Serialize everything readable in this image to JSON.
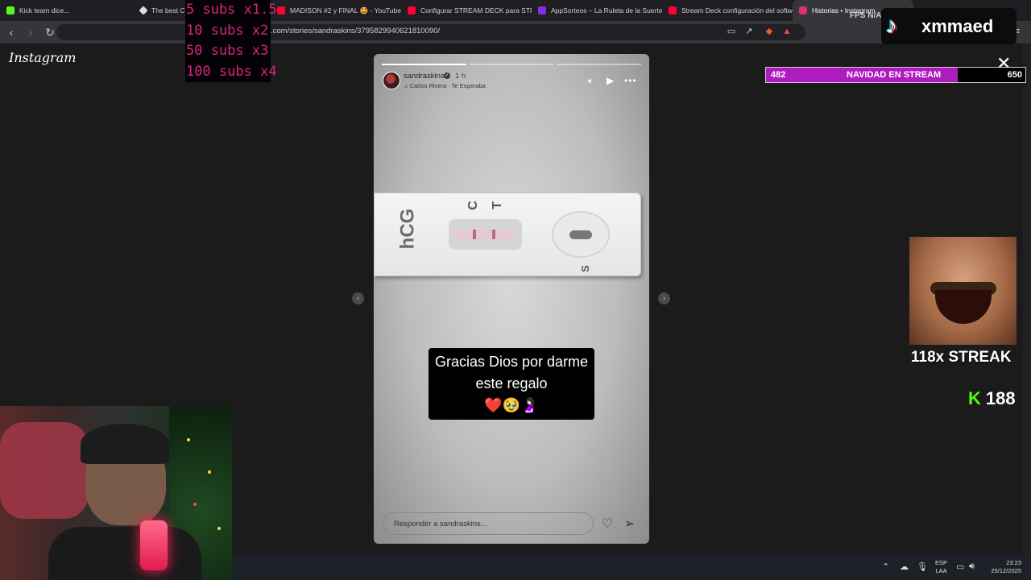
{
  "browser": {
    "tabs": [
      {
        "label": "Kick team dice...",
        "icon": "kick-icon",
        "color": "#53fc18"
      },
      {
        "label": "The best Ch",
        "icon": "diamond-icon",
        "color": "#dddddd"
      },
      {
        "label": "MADISON #2 y FINAL 🤩 - YouTube",
        "icon": "youtube-icon",
        "color": "#ff0033"
      },
      {
        "label": "Configurar STREAM DECK para STR",
        "icon": "youtube-icon",
        "color": "#ff0033"
      },
      {
        "label": "AppSorteos – La Ruleta de la Suerte",
        "icon": "appsorteos-icon",
        "color": "#8a2be2"
      },
      {
        "label": "Stream Deck configuración del softw",
        "icon": "youtube-icon",
        "color": "#ff0033"
      },
      {
        "label": "Historias • Instagram",
        "icon": "instagram-icon",
        "color": "#e1306c",
        "active": true
      }
    ],
    "url": ".com/stories/sandraskins/3795829940621810090/"
  },
  "page": {
    "logo": "Instagram"
  },
  "story": {
    "username": "sandraskins",
    "time": "1 h",
    "music": "Carlos Rivera · Te Esperaba",
    "caption_line1": "Gracias Dios por darme",
    "caption_line2": "este regalo",
    "caption_emoji": "❤️🥹🤰🏻",
    "test_brand": "hCG",
    "test_c": "C",
    "test_t": "T",
    "test_s": "S",
    "reply_placeholder": "Responder a sandraskins...",
    "progress": {
      "segments": 3,
      "active_index": 0
    }
  },
  "overlay": {
    "subs_lines": [
      "5 subs x1.5",
      "10 subs x2",
      "50 subs x3",
      "100 subs x4"
    ],
    "fps": "FPS N/A",
    "fps_right": "N/A",
    "tiktok_name": "xmmaed",
    "goal": {
      "current": "482",
      "title": "NAVIDAD EN STREAM",
      "target": "650",
      "progress": 0.74
    },
    "streak": "118x STREAK",
    "kick_count": "188"
  },
  "taskbar": {
    "lang_line1": "ESP",
    "lang_line2": "LAA",
    "time": "23:23",
    "date": "25/12/2025"
  }
}
